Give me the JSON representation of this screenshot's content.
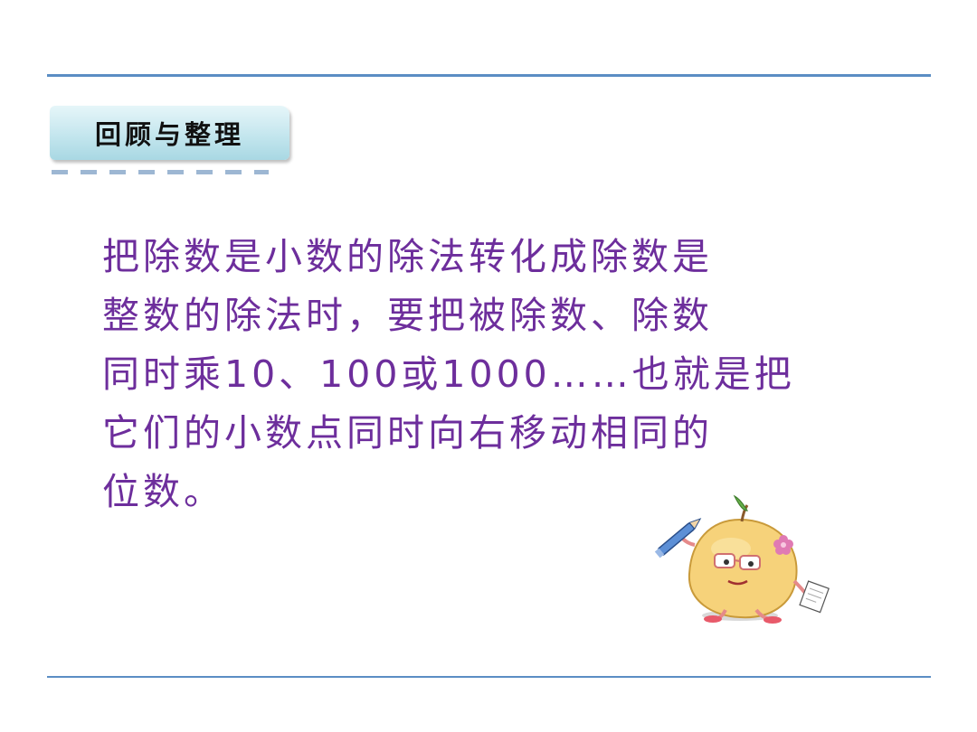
{
  "section": {
    "title": "回顾与整理"
  },
  "body": {
    "lines": [
      "把除数是小数的除法转化成除数是",
      "整数的除法时，要把被除数、除数",
      "同时乘10、100或1000……也就是把",
      "它们的小数点同时向右移动相同的",
      "位数。"
    ]
  },
  "colors": {
    "accent_rule": "#5b8dc4",
    "text": "#6d2e9c",
    "tab": "#c4e6ee"
  },
  "icons": {
    "mascot": "pear-character-with-pencil-icon"
  }
}
